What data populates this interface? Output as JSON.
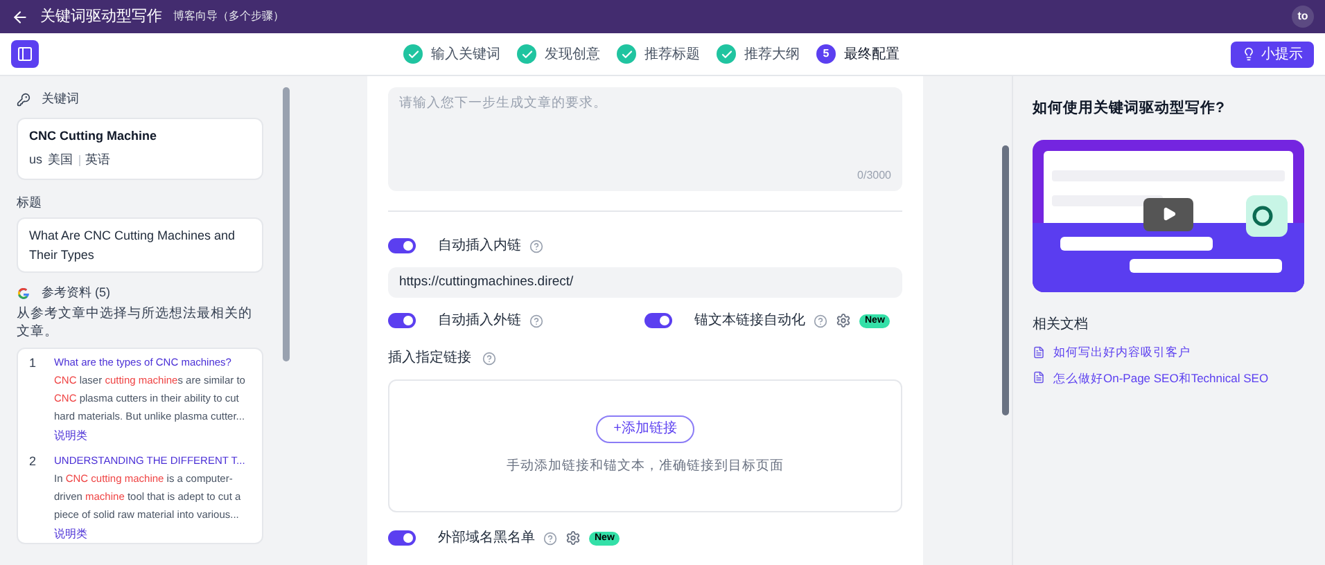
{
  "header": {
    "title": "关键词驱动型写作",
    "subtitle": "博客向导（多个步骤）",
    "avatar": "to"
  },
  "steps": [
    {
      "label": "输入关键词",
      "done": true
    },
    {
      "label": "发现创意",
      "done": true
    },
    {
      "label": "推荐标题",
      "done": true
    },
    {
      "label": "推荐大纲",
      "done": true
    },
    {
      "number": "5",
      "label": "最终配置",
      "done": false
    }
  ],
  "tips_button": "小提示",
  "sidebar": {
    "keyword_label": "关键词",
    "keyword": "CNC Cutting Machine",
    "country_code": "us",
    "country": "美国",
    "language": "英语",
    "title_label": "标题",
    "title": "What Are CNC Cutting Machines and Their Types",
    "references_label": "参考资料 (5)",
    "references_hint": "从参考文章中选择与所选想法最相关的文章。",
    "references": [
      {
        "index": "1",
        "title": "What are the types of CNC machines?",
        "snippet": [
          {
            "text": "CNC",
            "highlight": true
          },
          {
            "text": " laser ",
            "highlight": false
          },
          {
            "text": "cutting machine",
            "highlight": true
          },
          {
            "text": "s are similar to ",
            "highlight": false
          },
          {
            "text": "CNC",
            "highlight": true
          },
          {
            "text": " plasma cutters in their ability to cut hard materials. But unlike plasma cutter...",
            "highlight": false
          }
        ],
        "tag": "说明类"
      },
      {
        "index": "2",
        "title": "UNDERSTANDING THE DIFFERENT T...",
        "snippet": [
          {
            "text": "In ",
            "highlight": false
          },
          {
            "text": "CNC cutting machine",
            "highlight": true
          },
          {
            "text": " is a computer-driven ",
            "highlight": false
          },
          {
            "text": "machine",
            "highlight": true
          },
          {
            "text": " tool that is adept to cut a piece of solid raw material into various...",
            "highlight": false
          }
        ],
        "tag": "说明类"
      }
    ]
  },
  "editor": {
    "requirements": {
      "placeholder": "请输入您下一步生成文章的要求。",
      "counter": "0/3000"
    },
    "internal_links": {
      "label": "自动插入内链",
      "on": true
    },
    "site_url": "https://cuttingmachines.direct/",
    "options_row": [
      {
        "label": "自动插入外链",
        "on": true,
        "settings": false
      },
      {
        "label": "锚文本链接自动化",
        "on": true,
        "settings": true,
        "badge": "New"
      }
    ],
    "custom_links": {
      "label": "插入指定链接",
      "add_button": "+添加链接",
      "hint": "手动添加链接和锚文本，准确链接到目标页面"
    },
    "blacklist": {
      "label": "外部域名黑名单",
      "on": true,
      "settings": true,
      "badge": "New"
    }
  },
  "help": {
    "title": "如何使用关键词驱动型写作?",
    "docs_label": "相关文档",
    "docs": [
      "如何写出好内容吸引客户",
      "怎么做好On-Page SEO和Technical SEO"
    ]
  }
}
